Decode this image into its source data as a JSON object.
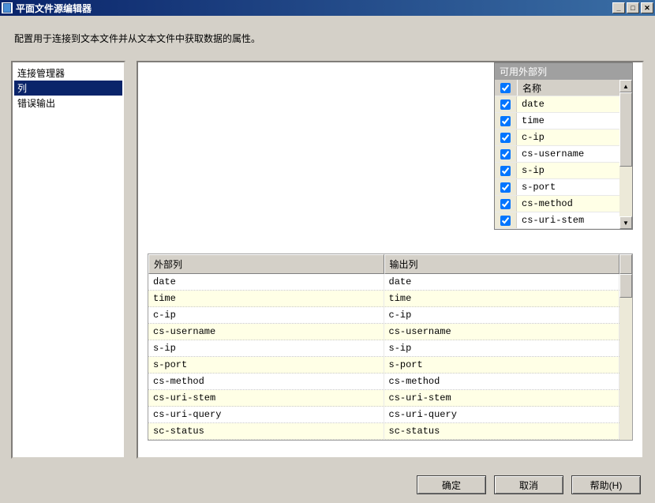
{
  "window": {
    "title": "平面文件源编辑器"
  },
  "description": "配置用于连接到文本文件并从文本文件中获取数据的属性。",
  "nav": {
    "items": [
      {
        "label": "连接管理器",
        "selected": false
      },
      {
        "label": "列",
        "selected": true
      },
      {
        "label": "错误输出",
        "selected": false
      }
    ]
  },
  "availableColumns": {
    "title": "可用外部列",
    "headerName": "名称",
    "rows": [
      {
        "name": "date",
        "checked": true
      },
      {
        "name": "time",
        "checked": true
      },
      {
        "name": "c-ip",
        "checked": true
      },
      {
        "name": "cs-username",
        "checked": true
      },
      {
        "name": "s-ip",
        "checked": true
      },
      {
        "name": "s-port",
        "checked": true
      },
      {
        "name": "cs-method",
        "checked": true
      },
      {
        "name": "cs-uri-stem",
        "checked": true
      }
    ]
  },
  "mapping": {
    "headers": {
      "external": "外部列",
      "output": "输出列"
    },
    "rows": [
      {
        "external": "date",
        "output": "date"
      },
      {
        "external": "time",
        "output": "time"
      },
      {
        "external": "c-ip",
        "output": "c-ip"
      },
      {
        "external": "cs-username",
        "output": "cs-username"
      },
      {
        "external": "s-ip",
        "output": "s-ip"
      },
      {
        "external": "s-port",
        "output": "s-port"
      },
      {
        "external": "cs-method",
        "output": "cs-method"
      },
      {
        "external": "cs-uri-stem",
        "output": "cs-uri-stem"
      },
      {
        "external": "cs-uri-query",
        "output": "cs-uri-query"
      },
      {
        "external": "sc-status",
        "output": "sc-status"
      }
    ]
  },
  "buttons": {
    "ok": "确定",
    "cancel": "取消",
    "help": "帮助(H)"
  }
}
